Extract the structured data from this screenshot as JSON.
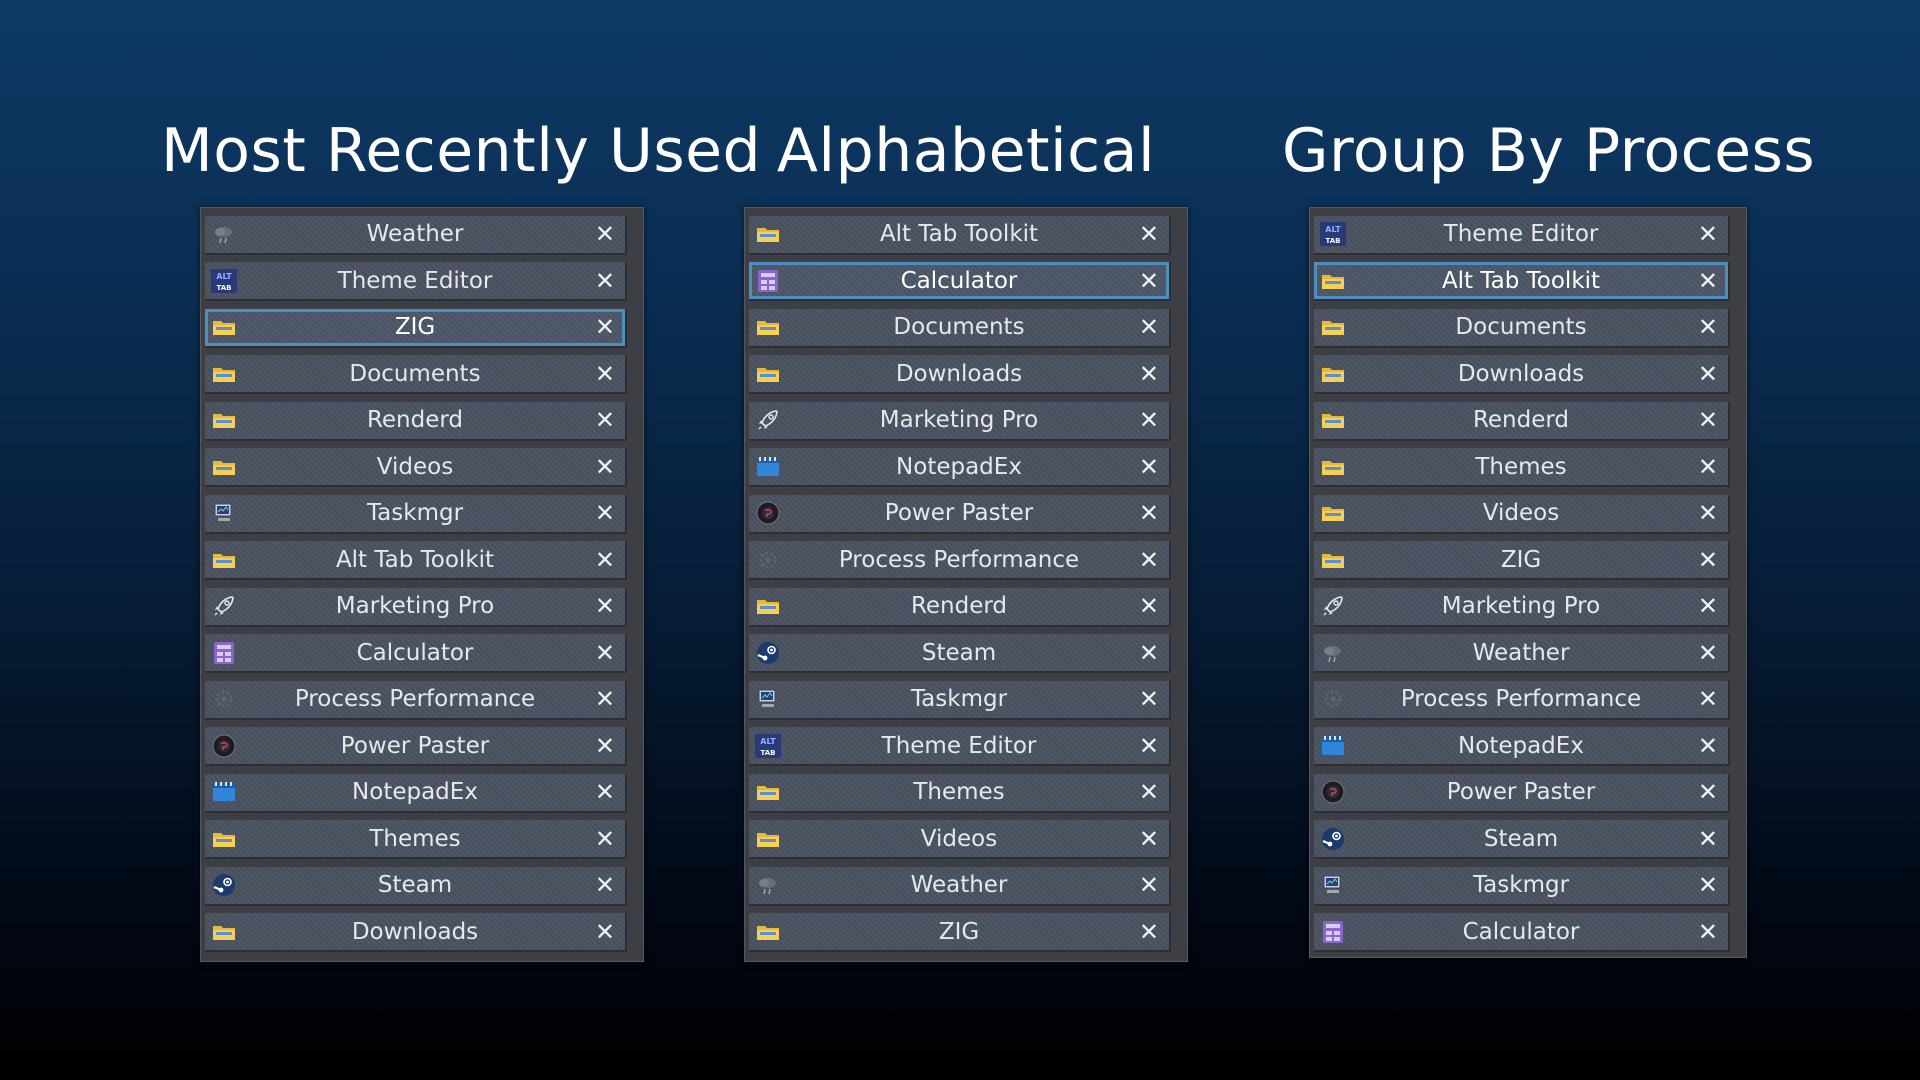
{
  "columns": [
    {
      "title": "Most Recently Used",
      "items": [
        {
          "label": "Weather",
          "icon": "weather-icon",
          "selected": false
        },
        {
          "label": "Theme Editor",
          "icon": "alt-tab-icon",
          "selected": false
        },
        {
          "label": "ZIG",
          "icon": "folder-icon",
          "selected": true
        },
        {
          "label": "Documents",
          "icon": "folder-icon",
          "selected": false
        },
        {
          "label": "Renderd",
          "icon": "folder-icon",
          "selected": false
        },
        {
          "label": "Videos",
          "icon": "folder-icon",
          "selected": false
        },
        {
          "label": "Taskmgr",
          "icon": "taskmgr-icon",
          "selected": false
        },
        {
          "label": "Alt Tab Toolkit",
          "icon": "folder-icon",
          "selected": false
        },
        {
          "label": "Marketing Pro",
          "icon": "rocket-icon",
          "selected": false
        },
        {
          "label": "Calculator",
          "icon": "calculator-icon",
          "selected": false
        },
        {
          "label": "Process Performance",
          "icon": "gear-icon",
          "selected": false
        },
        {
          "label": "Power Paster",
          "icon": "power-paster-icon",
          "selected": false
        },
        {
          "label": "NotepadEx",
          "icon": "notepad-icon",
          "selected": false
        },
        {
          "label": "Themes",
          "icon": "folder-icon",
          "selected": false
        },
        {
          "label": "Steam",
          "icon": "steam-icon",
          "selected": false
        },
        {
          "label": "Downloads",
          "icon": "folder-icon",
          "selected": false
        }
      ]
    },
    {
      "title": "Alphabetical",
      "items": [
        {
          "label": "Alt Tab Toolkit",
          "icon": "folder-icon",
          "selected": false
        },
        {
          "label": "Calculator",
          "icon": "calculator-icon",
          "selected": true
        },
        {
          "label": "Documents",
          "icon": "folder-icon",
          "selected": false
        },
        {
          "label": "Downloads",
          "icon": "folder-icon",
          "selected": false
        },
        {
          "label": "Marketing Pro",
          "icon": "rocket-icon",
          "selected": false
        },
        {
          "label": "NotepadEx",
          "icon": "notepad-icon",
          "selected": false
        },
        {
          "label": "Power Paster",
          "icon": "power-paster-icon",
          "selected": false
        },
        {
          "label": "Process Performance",
          "icon": "gear-icon",
          "selected": false
        },
        {
          "label": "Renderd",
          "icon": "folder-icon",
          "selected": false
        },
        {
          "label": "Steam",
          "icon": "steam-icon",
          "selected": false
        },
        {
          "label": "Taskmgr",
          "icon": "taskmgr-icon",
          "selected": false
        },
        {
          "label": "Theme Editor",
          "icon": "alt-tab-icon",
          "selected": false
        },
        {
          "label": "Themes",
          "icon": "folder-icon",
          "selected": false
        },
        {
          "label": "Videos",
          "icon": "folder-icon",
          "selected": false
        },
        {
          "label": "Weather",
          "icon": "weather-icon",
          "selected": false
        },
        {
          "label": "ZIG",
          "icon": "folder-icon",
          "selected": false
        }
      ]
    },
    {
      "title": "Group By Process",
      "items": [
        {
          "label": "Theme Editor",
          "icon": "alt-tab-icon",
          "selected": false
        },
        {
          "label": "Alt Tab Toolkit",
          "icon": "folder-icon",
          "selected": true
        },
        {
          "label": "Documents",
          "icon": "folder-icon",
          "selected": false
        },
        {
          "label": "Downloads",
          "icon": "folder-icon",
          "selected": false
        },
        {
          "label": "Renderd",
          "icon": "folder-icon",
          "selected": false
        },
        {
          "label": "Themes",
          "icon": "folder-icon",
          "selected": false
        },
        {
          "label": "Videos",
          "icon": "folder-icon",
          "selected": false
        },
        {
          "label": "ZIG",
          "icon": "folder-icon",
          "selected": false
        },
        {
          "label": "Marketing Pro",
          "icon": "rocket-icon",
          "selected": false
        },
        {
          "label": "Weather",
          "icon": "weather-icon",
          "selected": false
        },
        {
          "label": "Process Performance",
          "icon": "gear-icon",
          "selected": false
        },
        {
          "label": "NotepadEx",
          "icon": "notepad-icon",
          "selected": false
        },
        {
          "label": "Power Paster",
          "icon": "power-paster-icon",
          "selected": false
        },
        {
          "label": "Steam",
          "icon": "steam-icon",
          "selected": false
        },
        {
          "label": "Taskmgr",
          "icon": "taskmgr-icon",
          "selected": false
        },
        {
          "label": "Calculator",
          "icon": "calculator-icon",
          "selected": false
        }
      ]
    }
  ],
  "close_glyph": "✕",
  "colors": {
    "selected_border": "#4f8fbf",
    "row_bg": "#4a5261",
    "panel_bg": "#3d3f44"
  }
}
